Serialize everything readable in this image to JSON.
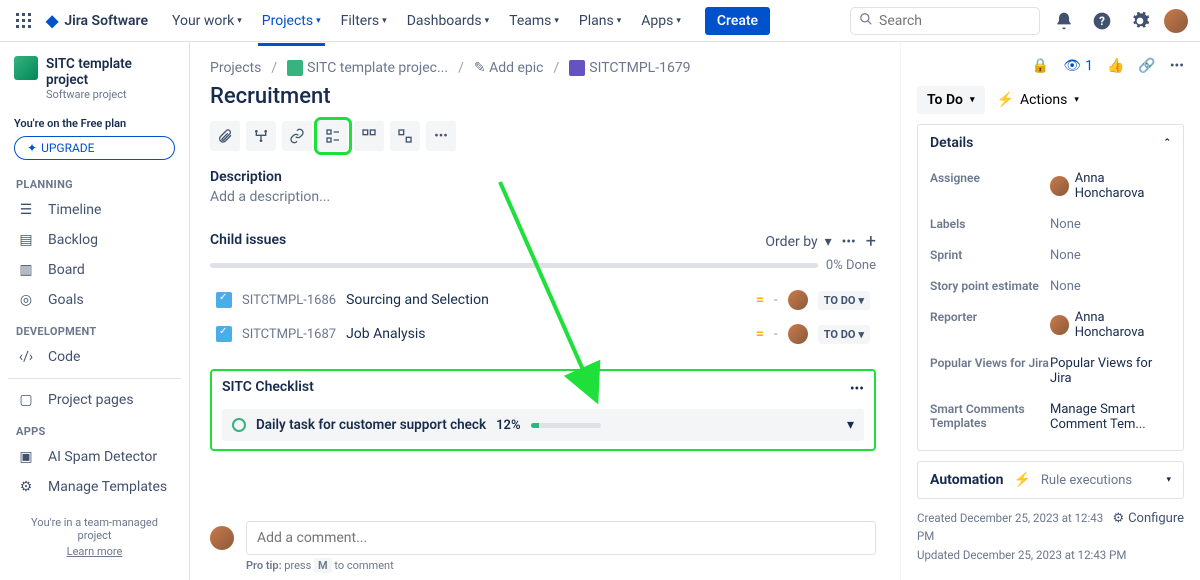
{
  "nav": {
    "product": "Jira Software",
    "items": [
      "Your work",
      "Projects",
      "Filters",
      "Dashboards",
      "Teams",
      "Plans",
      "Apps"
    ],
    "create": "Create",
    "search_ph": "Search"
  },
  "sidebar": {
    "project_name": "SITC template project",
    "project_type": "Software project",
    "free_plan": "You're on the Free plan",
    "upgrade": "UPGRADE",
    "sections": {
      "planning": "PLANNING",
      "development": "DEVELOPMENT",
      "apps": "APPS"
    },
    "items": {
      "timeline": "Timeline",
      "backlog": "Backlog",
      "board": "Board",
      "goals": "Goals",
      "code": "Code",
      "project_pages": "Project pages",
      "spam": "AI Spam Detector",
      "templates": "Manage Templates"
    },
    "foot1": "You're in a team-managed project",
    "foot2": "Learn more"
  },
  "crumbs": {
    "projects": "Projects",
    "project": "SITC template projec...",
    "addepic": "Add epic",
    "key": "SITCTMPL-1679"
  },
  "issue_title": "Recruitment",
  "desc": {
    "label": "Description",
    "ph": "Add a description..."
  },
  "children": {
    "label": "Child issues",
    "order": "Order by",
    "done": "0% Done",
    "items": [
      {
        "key": "SITCTMPL-1686",
        "title": "Sourcing and Selection",
        "status": "TO DO"
      },
      {
        "key": "SITCTMPL-1687",
        "title": "Job Analysis",
        "status": "TO DO"
      }
    ]
  },
  "checklist": {
    "label": "SITC Checklist",
    "item": "Daily task for customer support check",
    "pct": "12%"
  },
  "comment": {
    "ph": "Add a comment...",
    "tip_pre": "Pro tip:",
    "tip_mid": "press",
    "key": "M",
    "tip_post": "to comment"
  },
  "details": {
    "status": "To Do",
    "actions": "Actions",
    "title": "Details",
    "fields": {
      "assignee": {
        "label": "Assignee",
        "value": "Anna Honcharova"
      },
      "labels": {
        "label": "Labels",
        "value": "None"
      },
      "sprint": {
        "label": "Sprint",
        "value": "None"
      },
      "estimate": {
        "label": "Story point estimate",
        "value": "None"
      },
      "reporter": {
        "label": "Reporter",
        "value": "Anna Honcharova"
      },
      "views": {
        "label": "Popular Views for Jira",
        "value": "Popular Views for Jira"
      },
      "smart": {
        "label": "Smart Comments Templates",
        "value": "Manage Smart Comment Tem..."
      }
    },
    "automation": "Automation",
    "rule_exec": "Rule executions",
    "created": "Created December 25, 2023 at 12:43 PM",
    "updated": "Updated December 25, 2023 at 12:43 PM",
    "configure": "Configure",
    "watchers": "1"
  }
}
